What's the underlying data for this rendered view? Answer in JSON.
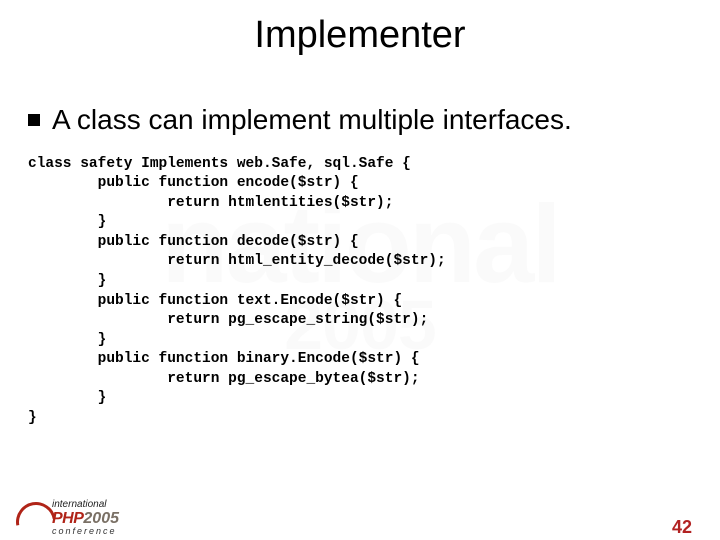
{
  "slide": {
    "title": "Implementer",
    "bullet": "A class can implement multiple interfaces.",
    "code": "class safety Implements web.Safe, sql.Safe {\n        public function encode($str) {\n                return htmlentities($str);\n        }\n        public function decode($str) {\n                return html_entity_decode($str);\n        }\n        public function text.Encode($str) {\n                return pg_escape_string($str);\n        }\n        public function binary.Encode($str) {\n                return pg_escape_bytea($str);\n        }\n}",
    "page_number": "42"
  },
  "logo": {
    "line1": "international",
    "brand": "PHP",
    "year": "2005",
    "line3": "conference"
  },
  "watermark": {
    "line1": "national",
    "line2": "2005"
  }
}
